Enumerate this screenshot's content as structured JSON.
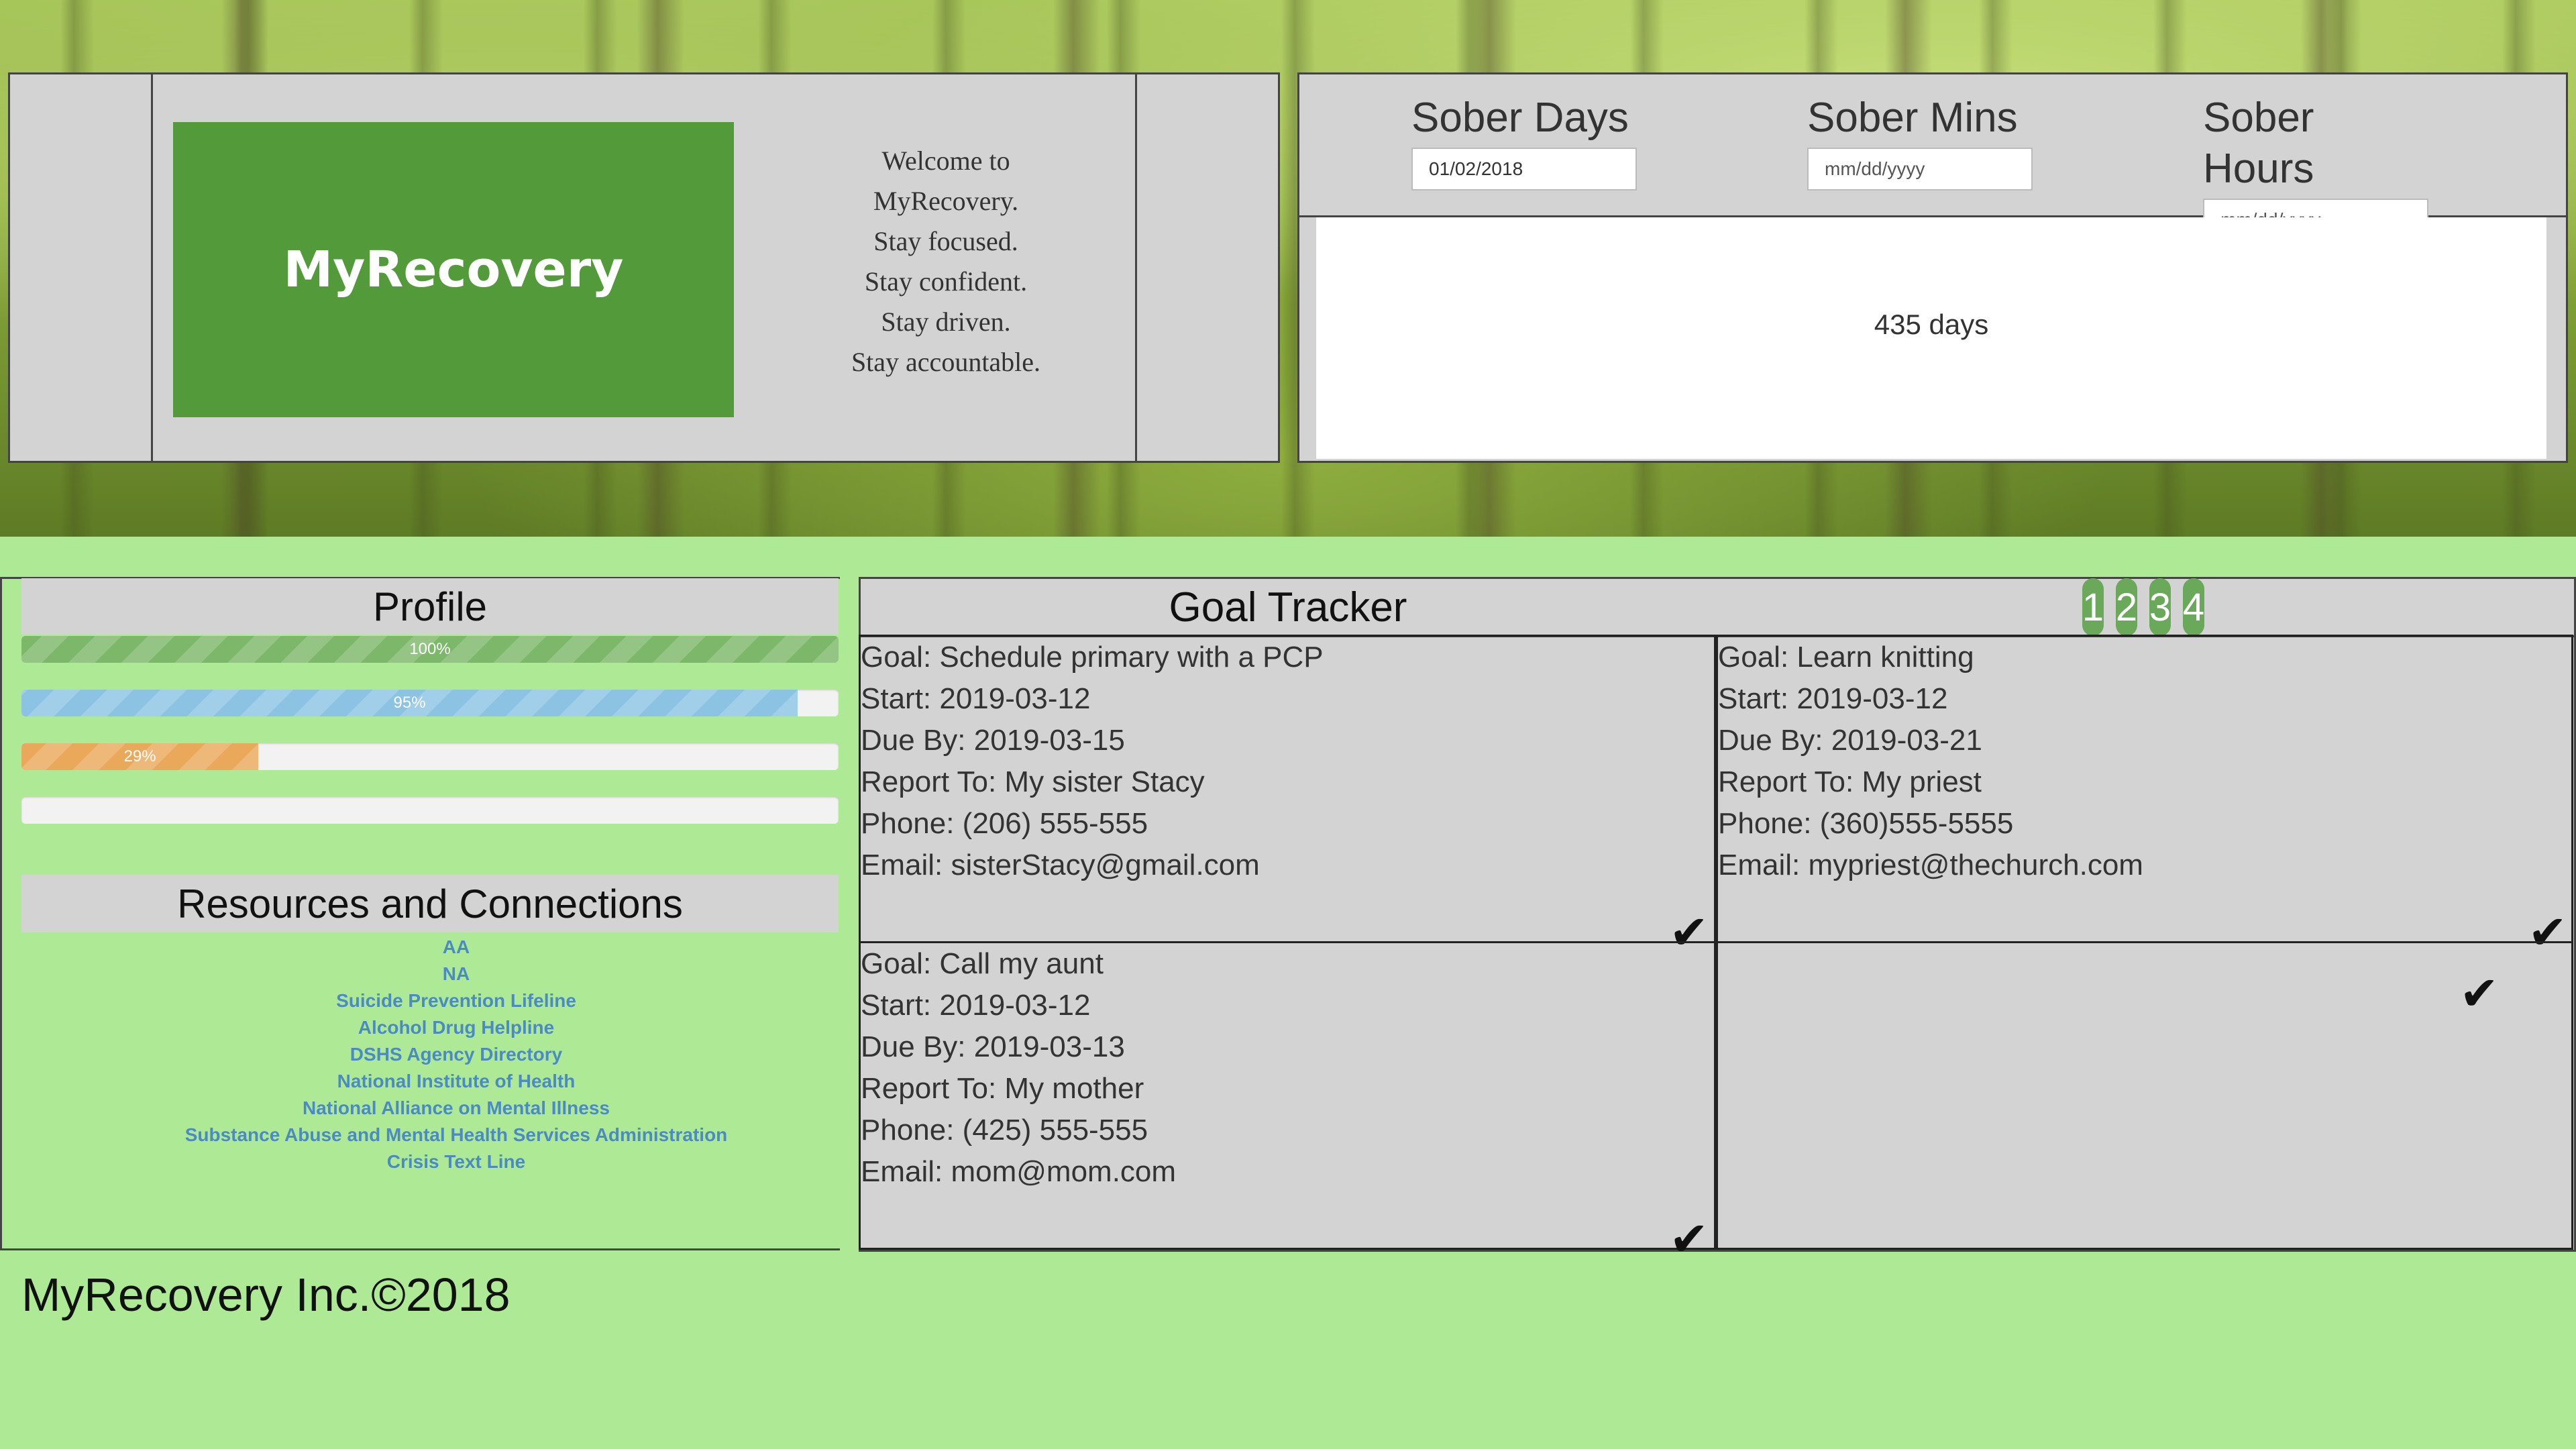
{
  "brand": {
    "logo_text": "MyRecovery"
  },
  "welcome": {
    "lines": [
      "Welcome to",
      "MyRecovery.",
      "Stay focused.",
      "Stay confident.",
      "Stay driven.",
      "Stay accountable."
    ]
  },
  "sober": {
    "days": {
      "title": "Sober Days",
      "value": "01/02/2018",
      "placeholder": "mm/dd/yyyy"
    },
    "mins": {
      "title": "Sober Mins",
      "value": "",
      "placeholder": "mm/dd/yyyy"
    },
    "hours": {
      "title": "Sober Hours",
      "value": "",
      "placeholder": "mm/dd/yyyy"
    },
    "result": "435 days"
  },
  "profile": {
    "title": "Profile",
    "progress": [
      {
        "label": "100%",
        "value": 100,
        "color": "#7db86a"
      },
      {
        "label": "95%",
        "value": 95,
        "color": "#8cc3e3"
      },
      {
        "label": "29%",
        "value": 29,
        "color": "#eaa85a"
      },
      {
        "label": "",
        "value": 0,
        "color": "#d9534f"
      }
    ]
  },
  "resources": {
    "title": "Resources and Connections",
    "links": [
      "AA",
      "NA",
      "Suicide Prevention Lifeline",
      "Alcohol Drug Helpline",
      "DSHS Agency Directory",
      "National Institute of Health",
      "National Alliance on Mental Illness",
      "Substance Abuse and Mental Health Services Administration",
      "Crisis Text Line"
    ]
  },
  "goals": {
    "title": "Goal Tracker",
    "pages": [
      "1",
      "2",
      "3",
      "4"
    ],
    "check_icon": "✔",
    "cards": [
      {
        "goal": "Goal: Schedule primary with a PCP",
        "start": "Start: 2019-03-12",
        "due": "Due By: 2019-03-15",
        "report": "Report To: My sister Stacy",
        "phone": "Phone: (206) 555-555",
        "email": "Email: sisterStacy@gmail.com"
      },
      {
        "goal": "Goal: Learn knitting",
        "start": "Start: 2019-03-12",
        "due": "Due By: 2019-03-21",
        "report": "Report To: My priest",
        "phone": "Phone: (360)555-5555",
        "email": "Email: mypriest@thechurch.com"
      },
      {
        "goal": "Goal: Call my aunt",
        "start": "Start: 2019-03-12",
        "due": "Due By: 2019-03-13",
        "report": "Report To: My mother",
        "phone": "Phone: (425) 555-555",
        "email": "Email: mom@mom.com"
      },
      {
        "goal": "",
        "start": "",
        "due": "",
        "report": "",
        "phone": "",
        "email": ""
      }
    ]
  },
  "footer": {
    "text": "MyRecovery Inc.©2018"
  }
}
